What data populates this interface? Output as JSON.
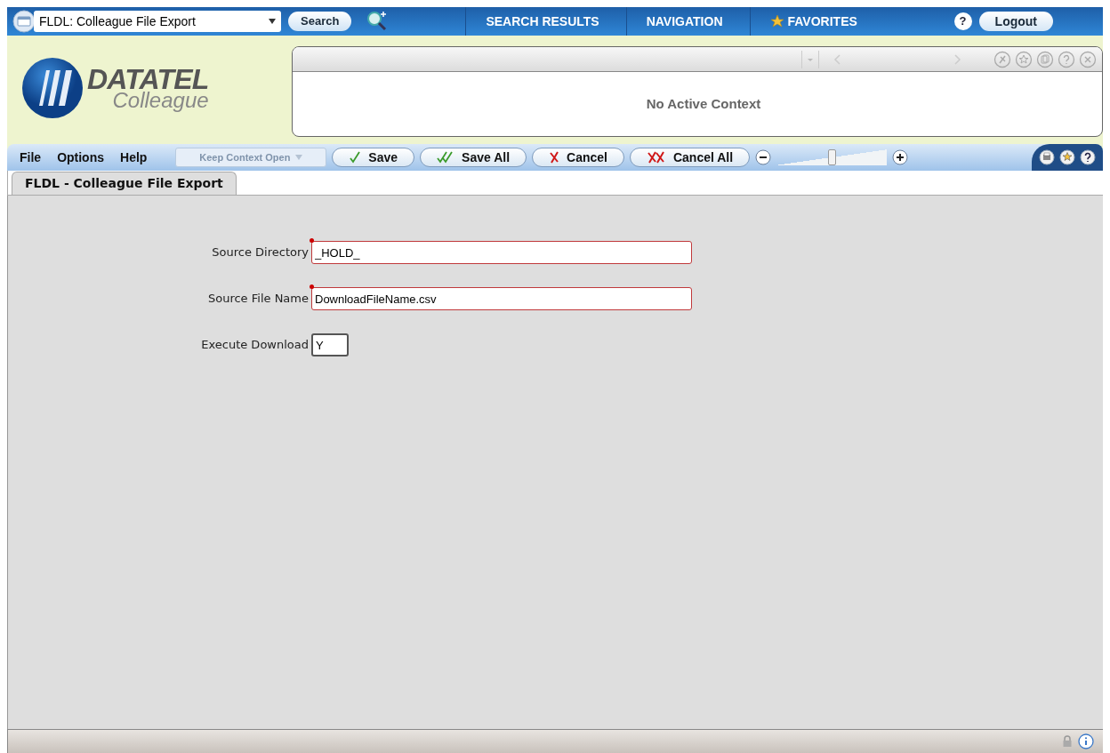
{
  "top_bar": {
    "form_select": {
      "value": "FLDL: Colleague File Export"
    },
    "search_button": "Search",
    "nav_tabs": [
      {
        "label": "SEARCH RESULTS",
        "kind": "plain"
      },
      {
        "label": "NAVIGATION",
        "kind": "plain"
      },
      {
        "label": "FAVORITES",
        "kind": "star"
      }
    ],
    "help_button": "?",
    "logout_button": "Logout"
  },
  "logo": {
    "wordmark": "DATATEL",
    "product": "Colleague"
  },
  "context_panel": {
    "message": "No Active Context"
  },
  "menu_bar": {
    "menus": [
      "File",
      "Options",
      "Help"
    ],
    "keep_context": {
      "label": "Keep Context Open",
      "disabled": true
    },
    "buttons": [
      {
        "label": "Save",
        "kind": "check"
      },
      {
        "label": "Save All",
        "kind": "double-check"
      },
      {
        "label": "Cancel",
        "kind": "cross"
      },
      {
        "label": "Cancel All",
        "kind": "double-cross"
      }
    ],
    "zoom_slider": {
      "level": 0.5
    }
  },
  "tabs": [
    {
      "label": "FLDL - Colleague File Export",
      "selected": true
    }
  ],
  "form": {
    "fields": [
      {
        "label": "Source Directory",
        "value": "_HOLD_",
        "required": true,
        "kind": "wide"
      },
      {
        "label": "Source File Name",
        "value": "DownloadFileName.csv",
        "required": true,
        "kind": "wide"
      },
      {
        "label": "Execute Download",
        "value": "Y",
        "required": false,
        "kind": "short"
      }
    ]
  }
}
